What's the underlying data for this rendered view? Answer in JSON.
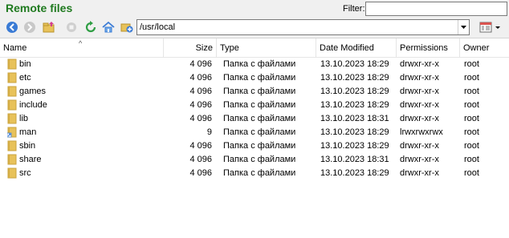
{
  "panel": {
    "title": "Remote files",
    "filter_label": "Filter:",
    "filter_value": ""
  },
  "toolbar": {
    "path": "/usr/local"
  },
  "columns": [
    "Name",
    "Size",
    "Type",
    "Date Modified",
    "Permissions",
    "Owner"
  ],
  "files": [
    {
      "name": "bin",
      "size": "4 096",
      "type": "Папка с файлами",
      "date": "13.10.2023 18:29",
      "perm": "drwxr-xr-x",
      "owner": "root",
      "icon": "folder-icon"
    },
    {
      "name": "etc",
      "size": "4 096",
      "type": "Папка с файлами",
      "date": "13.10.2023 18:29",
      "perm": "drwxr-xr-x",
      "owner": "root",
      "icon": "folder-icon"
    },
    {
      "name": "games",
      "size": "4 096",
      "type": "Папка с файлами",
      "date": "13.10.2023 18:29",
      "perm": "drwxr-xr-x",
      "owner": "root",
      "icon": "folder-icon"
    },
    {
      "name": "include",
      "size": "4 096",
      "type": "Папка с файлами",
      "date": "13.10.2023 18:29",
      "perm": "drwxr-xr-x",
      "owner": "root",
      "icon": "folder-icon"
    },
    {
      "name": "lib",
      "size": "4 096",
      "type": "Папка с файлами",
      "date": "13.10.2023 18:31",
      "perm": "drwxr-xr-x",
      "owner": "root",
      "icon": "folder-icon"
    },
    {
      "name": "man",
      "size": "9",
      "type": "Папка с файлами",
      "date": "13.10.2023 18:29",
      "perm": "lrwxrwxrwx",
      "owner": "root",
      "icon": "folder-link-icon"
    },
    {
      "name": "sbin",
      "size": "4 096",
      "type": "Папка с файлами",
      "date": "13.10.2023 18:29",
      "perm": "drwxr-xr-x",
      "owner": "root",
      "icon": "folder-icon"
    },
    {
      "name": "share",
      "size": "4 096",
      "type": "Папка с файлами",
      "date": "13.10.2023 18:31",
      "perm": "drwxr-xr-x",
      "owner": "root",
      "icon": "folder-icon"
    },
    {
      "name": "src",
      "size": "4 096",
      "type": "Папка с файлами",
      "date": "13.10.2023 18:29",
      "perm": "drwxr-xr-x",
      "owner": "root",
      "icon": "folder-icon"
    }
  ],
  "colors": {
    "title": "#1f7a1f",
    "folder": "#e8c25a"
  }
}
